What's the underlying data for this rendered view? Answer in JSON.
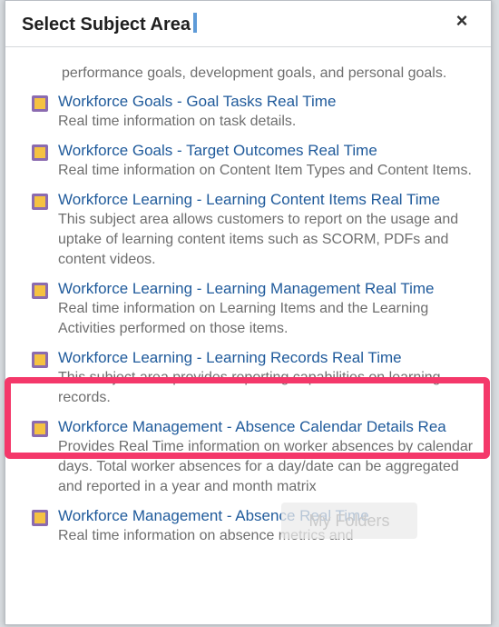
{
  "dialog": {
    "title": "Select Subject Area",
    "close_label": "×"
  },
  "fragment_text": "performance goals, development goals, and personal goals.",
  "items": [
    {
      "name": "Workforce Goals - Goal Tasks Real Time",
      "description": "Real time information on task details."
    },
    {
      "name": "Workforce Goals - Target Outcomes Real Time",
      "description": "Real time information on Content Item Types and Content Items."
    },
    {
      "name": "Workforce Learning - Learning Content Items Real Time",
      "description": "This subject area allows customers to report on the usage and uptake of learning content items such as SCORM, PDFs and content videos."
    },
    {
      "name": "Workforce Learning - Learning Management Real Time",
      "description": "Real time information on Learning Items and the Learning Activities performed on those items."
    },
    {
      "name": "Workforce Learning - Learning Records Real Time",
      "description": "This subject area provides reporting capabilities on learning records."
    },
    {
      "name": "Workforce Management - Absence Calendar Details Rea",
      "description": "Provides Real Time information on worker absences by calendar days. Total worker absences for a day/date can be aggregated and reported in a year and month matrix"
    },
    {
      "name": "Workforce Management - Absence Real Time",
      "description": "Real time information on absence metrics and"
    }
  ],
  "overlay_button": {
    "label": "My Folders"
  },
  "colors": {
    "highlight": "#f4386a",
    "link": "#1f5a9b",
    "icon_outer": "#8b6bb0",
    "icon_inner": "#f5c242"
  },
  "icons": {
    "subject_area": "subject-area-icon",
    "close": "close-icon"
  }
}
